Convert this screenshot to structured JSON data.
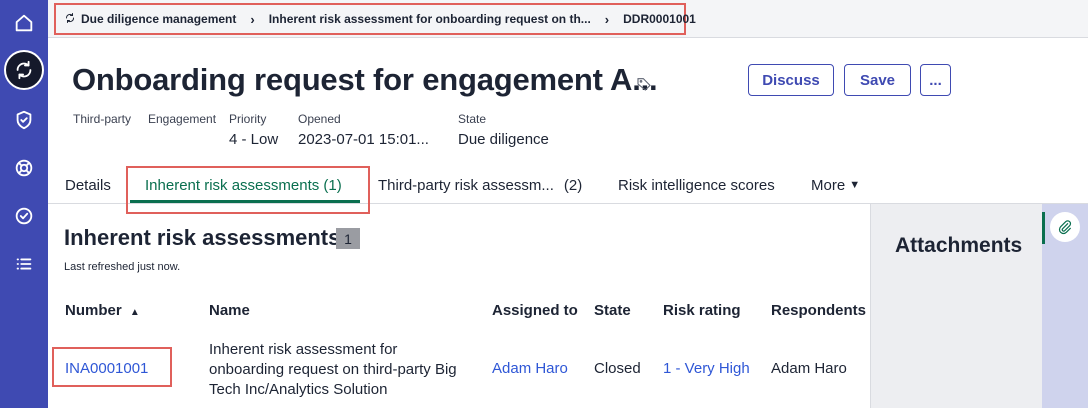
{
  "sidebar": {
    "items": [
      {
        "icon": "home-icon"
      },
      {
        "icon": "refresh-icon"
      },
      {
        "icon": "shield-check-icon"
      },
      {
        "icon": "lifebuoy-icon"
      },
      {
        "icon": "check-circle-icon"
      },
      {
        "icon": "list-icon"
      }
    ]
  },
  "breadcrumb": {
    "items": [
      {
        "label": "Due diligence management",
        "icon": "refresh-icon"
      },
      {
        "label": "Inherent risk assessment for onboarding request on th..."
      },
      {
        "label": "DDR0001001"
      }
    ]
  },
  "record": {
    "title": "Onboarding request for engagement A...",
    "tag_icon": "tag-icon",
    "fields": [
      {
        "label": "Third-party",
        "value": ""
      },
      {
        "label": "Engagement",
        "value": ""
      },
      {
        "label": "Priority",
        "value": "4 - Low"
      },
      {
        "label": "Opened",
        "value": "2023-07-01 15:01..."
      },
      {
        "label": "State",
        "value": "Due diligence"
      }
    ]
  },
  "actions": {
    "discuss": "Discuss",
    "save": "Save",
    "more": "..."
  },
  "tabs": [
    {
      "label": "Details"
    },
    {
      "label": "Inherent risk assessments (1)",
      "active": true
    },
    {
      "label": "Third-party risk assessm...",
      "count": "(2)"
    },
    {
      "label": "Risk intelligence scores"
    },
    {
      "label": "More"
    }
  ],
  "list": {
    "title": "Inherent risk assessments",
    "count": "1",
    "refreshed": "Last refreshed just now.",
    "columns": [
      "Number",
      "Name",
      "Assigned to",
      "State",
      "Risk rating",
      "Respondents"
    ],
    "sort": "ascending",
    "rows": [
      {
        "number": "INA0001001",
        "name_lines": [
          "Inherent risk assessment for",
          "onboarding request on third-party Big",
          "Tech Inc/Analytics Solution"
        ],
        "assigned_to": "Adam Haro",
        "state": "Closed",
        "risk_rating": "1 - Very High",
        "respondents": "Adam Haro"
      }
    ]
  },
  "attachments": {
    "title": "Attachments",
    "icon": "paperclip-icon"
  },
  "colors": {
    "sidebar": "#3f4ab2",
    "accent_green": "#0a6f4f",
    "link": "#2f57d6",
    "highlight": "#e0605b"
  }
}
